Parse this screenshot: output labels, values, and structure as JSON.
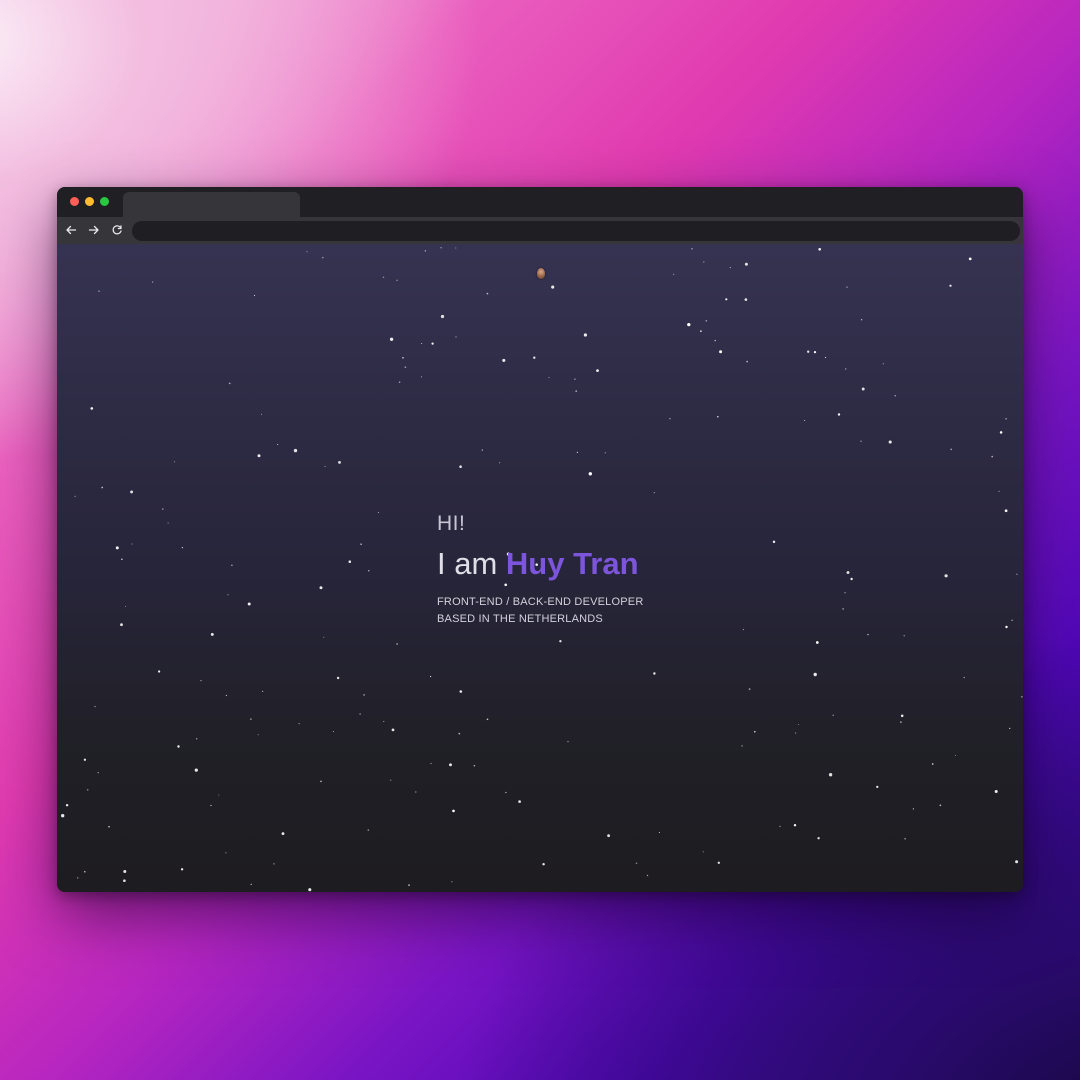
{
  "browser": {
    "tab_title": "",
    "address_value": "",
    "nav_icons": [
      "arrow-left-icon",
      "arrow-right-icon",
      "reload-icon"
    ],
    "traffic_lights": [
      "close",
      "minimize",
      "maximize"
    ]
  },
  "hero": {
    "greeting": "HI!",
    "intro_prefix": "I am ",
    "name": "Huy Tran",
    "role_line": "FRONT-END / BACK-END DEVELOPER",
    "location_line": "BASED IN THE NETHERLANDS"
  },
  "colors": {
    "accent": "#7d55dd",
    "page_bg_top": "#363352",
    "page_bg_bottom": "#1d1c20",
    "star": "#ffffff"
  }
}
